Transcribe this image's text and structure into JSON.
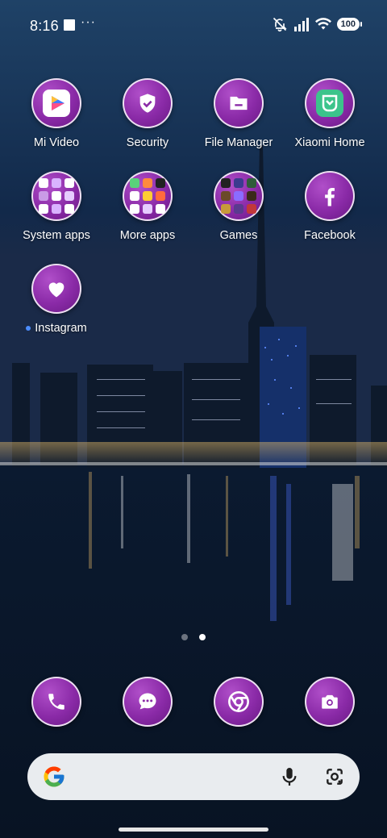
{
  "status_bar": {
    "time": "8:16",
    "more_indicator": "···",
    "battery": "100",
    "icons": [
      "notifications-muted-icon",
      "signal-icon",
      "wifi-icon",
      "battery-icon"
    ]
  },
  "apps": [
    {
      "label": "Mi Video",
      "icon": "mi-video-icon"
    },
    {
      "label": "Security",
      "icon": "shield-icon"
    },
    {
      "label": "File Manager",
      "icon": "folder-icon"
    },
    {
      "label": "Xiaomi Home",
      "icon": "xiaomi-home-icon"
    },
    {
      "label": "System apps",
      "icon": "folder-system-apps-icon"
    },
    {
      "label": "More apps",
      "icon": "folder-more-apps-icon"
    },
    {
      "label": "Games",
      "icon": "folder-games-icon"
    },
    {
      "label": "Facebook",
      "icon": "facebook-icon"
    },
    {
      "label": "Instagram",
      "icon": "instagram-icon",
      "new_indicator": true
    }
  ],
  "pages": {
    "count": 2,
    "active_index": 1
  },
  "dock": [
    {
      "name": "phone",
      "icon": "phone-icon"
    },
    {
      "name": "messages",
      "icon": "message-icon"
    },
    {
      "name": "chrome",
      "icon": "chrome-icon"
    },
    {
      "name": "camera",
      "icon": "camera-icon"
    }
  ],
  "search_bar": {
    "left_icon": "google-g-icon",
    "right_icons": [
      "microphone-icon",
      "google-lens-icon"
    ]
  },
  "colors": {
    "app_icon_purple": "#8a2aa7",
    "search_bar_bg": "#e9ecef",
    "new_indicator": "#4c8dff"
  }
}
